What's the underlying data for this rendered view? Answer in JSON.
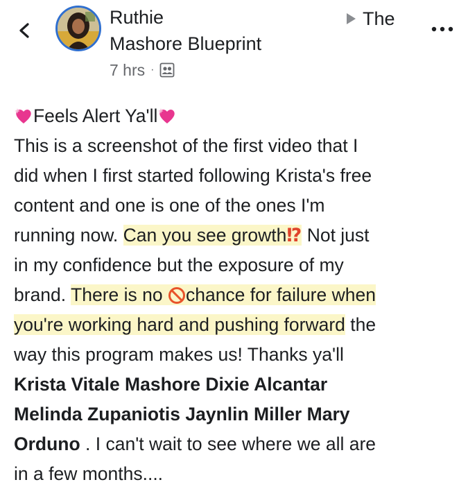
{
  "header": {
    "author": "Ruthie",
    "group_name": "Mashore Blueprint",
    "timestamp": "7 hrs",
    "separator": "·",
    "share_target": "The",
    "more_label": "..."
  },
  "icons": {
    "back": "chevron-left-icon",
    "audience": "group-audience-icon",
    "more": "more-dots-icon",
    "heart": "sparkling-heart-emoji",
    "exclamation": "exclamation-question-emoji",
    "prohibited": "no-entry-emoji"
  },
  "colors": {
    "avatar_ring": "#2f6fcf",
    "highlight": "#fbf6c8",
    "text": "#1c1e21",
    "meta": "#65676b",
    "heart": "#e8368f",
    "prohibited": "#e8532a"
  },
  "post": {
    "line1_text": "Feels Alert Ya'll",
    "line2": "This is a screenshot of the first video that I",
    "line3": "did when I first started following Krista's free",
    "line4": "content and one is one of the ones I'm",
    "line5_a": "running now. ",
    "line5_hl": "Can you see growth",
    "line5_exq": "⁉",
    "line5_b": " Not just",
    "line6": "in my confidence but the exposure of my",
    "line7_a": "brand. ",
    "line7_hl_a": "There is no ",
    "line7_hl_b": "chance for failure when",
    "line8_hl": "you're working hard and pushing forward",
    "line8_b": " the",
    "line9": "way this program makes us! Thanks ya'll",
    "tag1": "Krista Vitale Mashore",
    "tag2": "Dixie Alcantar",
    "tag3": "Melinda Zupaniotis",
    "tag4": "Jaynlin Miller",
    "tag5_a": "Mary",
    "tag5_b": "Orduno",
    "line12_after": " . I can't wait to see where we all are",
    "line13": "in a few months...."
  }
}
